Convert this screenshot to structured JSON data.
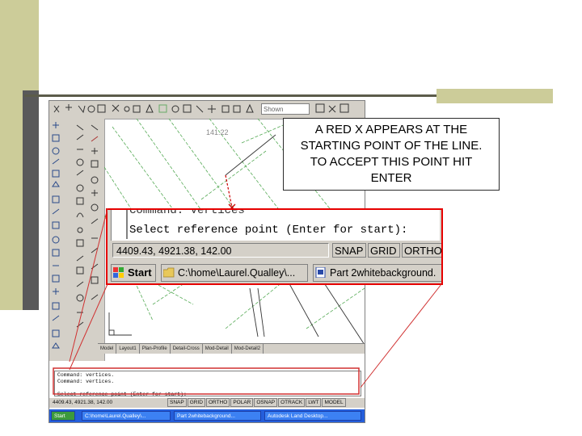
{
  "callout": {
    "text": "A RED X APPEARS AT THE STARTING POINT OF THE LINE.  TO ACCEPT THIS POINT HIT ENTER"
  },
  "drawing": {
    "elevation_label": "141.22"
  },
  "toolbar": {
    "layer_value": "Shown"
  },
  "layout_tabs": [
    "Model",
    "Layout1",
    "Plan-Profile",
    "Detail-Cross",
    "Mod-Detail",
    "Mod-Detail2"
  ],
  "command_line_small": {
    "lines": [
      "Command: vertices.",
      "Command: vertices.",
      "",
      "Select reference point (Enter for start):"
    ]
  },
  "status_small": {
    "coords": "4409.43, 4921.38, 142.00",
    "buttons": [
      "SNAP",
      "GRID",
      "ORTHO",
      "POLAR",
      "OSNAP",
      "OTRACK",
      "LWT",
      "MODEL"
    ]
  },
  "taskbar_small": {
    "start": "Start",
    "tasks": [
      "C:\\home\\Laurel.Qualley\\...",
      "Part 2whitebackground...",
      "Autodesk Land Desktop..."
    ]
  },
  "zoom": {
    "cut_line": "Command: Vertices",
    "prompt": "Select reference point (Enter for start):",
    "coords": "4409.43, 4921.38, 142.00",
    "buttons": [
      "SNAP",
      "GRID",
      "ORTHO"
    ],
    "start_label": "Start",
    "task1": "C:\\home\\Laurel.Qualley\\...",
    "task2": "Part 2whitebackground."
  },
  "colors": {
    "slide_band": "#cccc99",
    "callout_border": "#2b2b2b",
    "zoom_border": "#e60000",
    "drawing_lines": "#55aa55"
  }
}
